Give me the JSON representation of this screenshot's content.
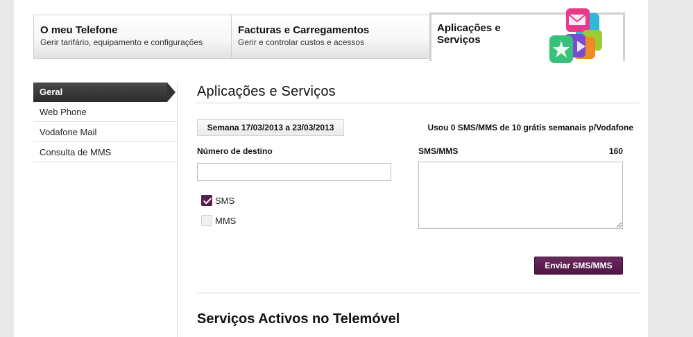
{
  "tabs": [
    {
      "title": "O meu Telefone",
      "subtitle": "Gerir tarifário, equipamento e configurações"
    },
    {
      "title": "Facturas e Carregamentos",
      "subtitle": "Gerir e controlar custos e acessos"
    },
    {
      "title": "Aplicações e Serviços",
      "icon": "apps-cube-icon"
    }
  ],
  "sidebar": {
    "items": [
      {
        "label": "Geral"
      },
      {
        "label": "Web Phone"
      },
      {
        "label": "Vodafone Mail"
      },
      {
        "label": "Consulta de MMS"
      }
    ]
  },
  "main": {
    "title": "Aplicações e Serviços",
    "week": "Semana 17/03/2013 a 23/03/2013",
    "usage": "Usou 0 SMS/MMS de 10 grátis semanais p/Vodafone",
    "dest_label": "Número de destino",
    "dest_value": "",
    "sms_label": "SMS",
    "mms_label": "MMS",
    "sms_checked": true,
    "mms_checked": false,
    "msg_label": "SMS/MMS",
    "char_count": "160",
    "message": "",
    "send_label": "Enviar SMS/MMS",
    "section2_title": "Serviços Activos no Telemóvel"
  },
  "colors": {
    "accent": "#5b1f4f",
    "sidebar_active": "#333333"
  }
}
